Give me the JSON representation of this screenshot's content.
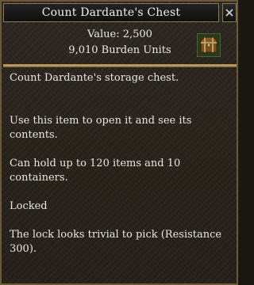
{
  "window": {
    "title": "Count Dardante's Chest"
  },
  "item": {
    "value": "Value: 2,500",
    "burden": "9,010 Burden Units",
    "icon": "chest-icon"
  },
  "description": {
    "name_line": "Count Dardante's storage chest.",
    "use_line": "Use this item to open it and see its contents.",
    "capacity_line": "Can hold up to 120 items and 10 containers.",
    "status_line": "Locked",
    "lock_line": "The lock looks trivial to pick (Resistance 300)."
  },
  "colors": {
    "border_gold": "#c8a860",
    "text": "#e6e6e6",
    "background": "#2a251d"
  }
}
